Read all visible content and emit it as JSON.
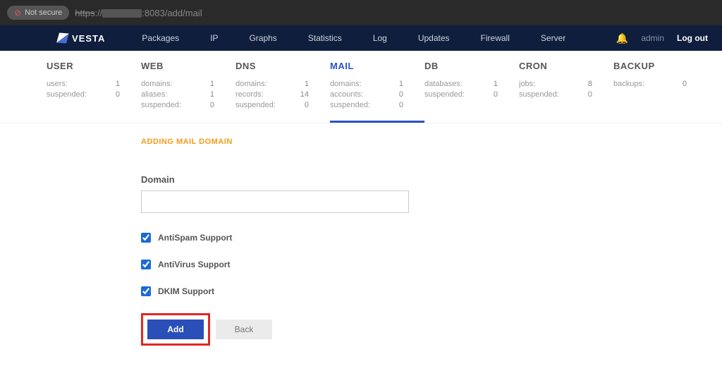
{
  "chrome": {
    "secure_label": "Not secure",
    "url_prefix": "https",
    "url_suffix": ":8083/add/mail"
  },
  "brand": "VESTA",
  "topnav": [
    "Packages",
    "IP",
    "Graphs",
    "Statistics",
    "Log",
    "Updates",
    "Firewall",
    "Server"
  ],
  "right": {
    "admin": "admin",
    "logout": "Log out"
  },
  "cats": [
    {
      "title": "USER",
      "active": false,
      "stats": [
        [
          "users:",
          "1"
        ],
        [
          "suspended:",
          "0"
        ]
      ]
    },
    {
      "title": "WEB",
      "active": false,
      "stats": [
        [
          "domains:",
          "1"
        ],
        [
          "aliases:",
          "1"
        ],
        [
          "suspended:",
          "0"
        ]
      ]
    },
    {
      "title": "DNS",
      "active": false,
      "stats": [
        [
          "domains:",
          "1"
        ],
        [
          "records:",
          "14"
        ],
        [
          "suspended:",
          "0"
        ]
      ]
    },
    {
      "title": "MAIL",
      "active": true,
      "stats": [
        [
          "domains:",
          "1"
        ],
        [
          "accounts:",
          "0"
        ],
        [
          "suspended:",
          "0"
        ]
      ]
    },
    {
      "title": "DB",
      "active": false,
      "stats": [
        [
          "databases:",
          "1"
        ],
        [
          "suspended:",
          "0"
        ]
      ]
    },
    {
      "title": "CRON",
      "active": false,
      "stats": [
        [
          "jobs:",
          "8"
        ],
        [
          "suspended:",
          "0"
        ]
      ]
    },
    {
      "title": "BACKUP",
      "active": false,
      "stats": [
        [
          "backups:",
          "0"
        ]
      ]
    }
  ],
  "form": {
    "section_title": "ADDING MAIL DOMAIN",
    "domain_label": "Domain",
    "domain_value": "",
    "checks": [
      {
        "label": "AntiSpam Support",
        "checked": true
      },
      {
        "label": "AntiVirus Support",
        "checked": true
      },
      {
        "label": "DKIM Support",
        "checked": true
      }
    ],
    "add_label": "Add",
    "back_label": "Back"
  }
}
